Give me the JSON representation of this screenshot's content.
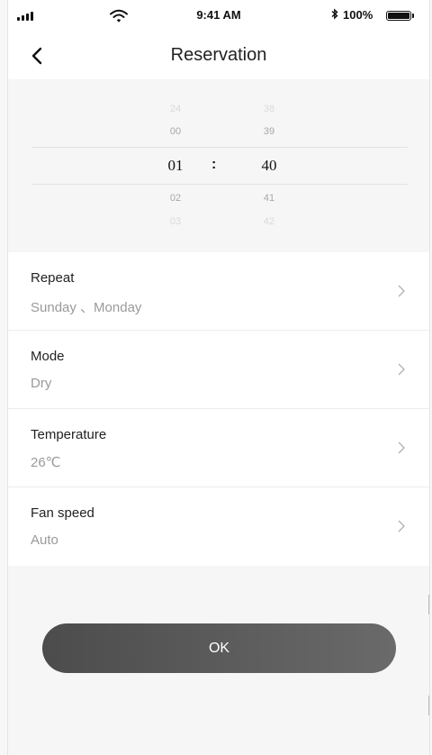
{
  "status_bar": {
    "time": "9:41 AM",
    "battery_percent": "100%",
    "signal_icon": "signal-bars-icon",
    "wifi_icon": "wifi-icon",
    "bluetooth_icon": "bluetooth-icon",
    "battery_icon": "battery-icon"
  },
  "nav": {
    "title": "Reservation",
    "back_icon": "chevron-left-icon"
  },
  "time_picker": {
    "hours": [
      "24",
      "00",
      "01",
      "02",
      "03"
    ],
    "minutes": [
      "38",
      "39",
      "40",
      "41",
      "42"
    ],
    "selected_hour": "01",
    "selected_minute": "40",
    "separator": ":"
  },
  "settings": [
    {
      "label": "Repeat",
      "value": "Sunday 、Monday"
    },
    {
      "label": "Mode",
      "value": "Dry"
    },
    {
      "label": "Temperature",
      "value": "26℃"
    },
    {
      "label": "Fan speed",
      "value": "Auto"
    }
  ],
  "ok_button": {
    "label": "OK"
  },
  "colors": {
    "button_gradient_start": "#4c4c4c",
    "button_gradient_end": "#6a6a6a",
    "background": "#f6f6f6",
    "secondary_text": "#9a9a9a"
  }
}
